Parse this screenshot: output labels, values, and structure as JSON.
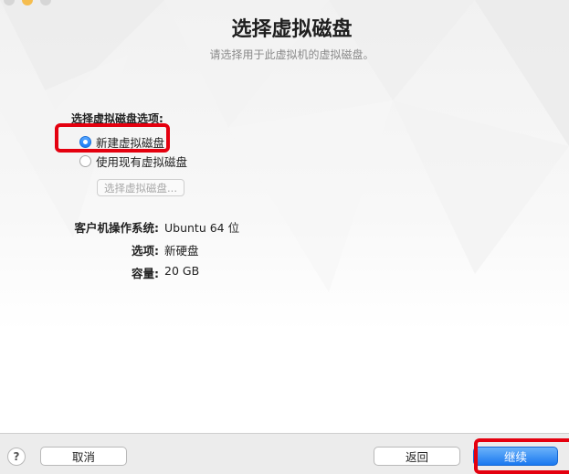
{
  "window": {
    "title": "选择虚拟磁盘",
    "subtitle": "请选择用于此虚拟机的虚拟磁盘。"
  },
  "disk_options": {
    "label": "选择虚拟磁盘选项:",
    "options": [
      {
        "label": "新建虚拟磁盘",
        "selected": true
      },
      {
        "label": "使用现有虚拟磁盘",
        "selected": false
      }
    ],
    "choose_button": "选择虚拟磁盘..."
  },
  "summary": [
    {
      "key": "客户机操作系统:",
      "value": "Ubuntu 64 位"
    },
    {
      "key": "选项:",
      "value": "新硬盘"
    },
    {
      "key": "容量:",
      "value": "20 GB"
    }
  ],
  "footer": {
    "help_label": "?",
    "cancel_label": "取消",
    "back_label": "返回",
    "continue_label": "继续"
  },
  "colors": {
    "accent": "#1a78f0",
    "highlight": "#e4000f"
  }
}
